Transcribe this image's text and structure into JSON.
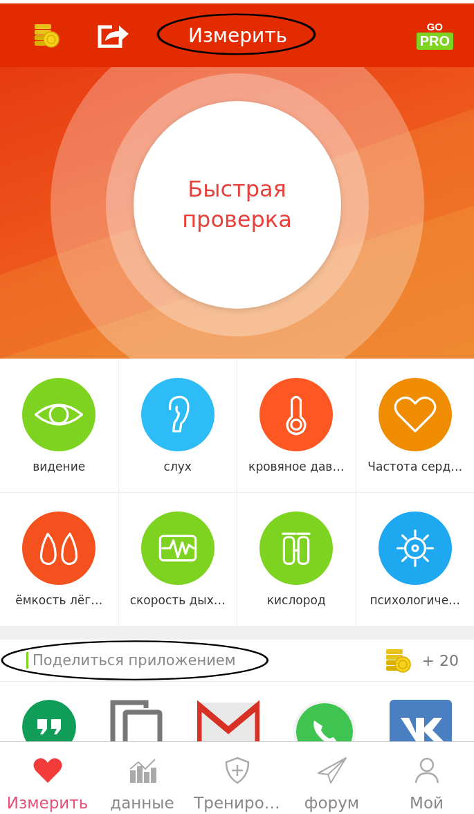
{
  "top_bar": {
    "title": "Измерить",
    "pro_badge": {
      "top": "GO",
      "label": "PRO"
    }
  },
  "hero": {
    "button": "Быстрая проверка"
  },
  "tests": [
    {
      "label": "видение",
      "color": "#7ed321"
    },
    {
      "label": "слух",
      "color": "#2ebcf7"
    },
    {
      "label": "кровяное дав…",
      "color": "#ff5722"
    },
    {
      "label": "Частота серд…",
      "color": "#f08c00"
    },
    {
      "label": "ёмкость лёг…",
      "color": "#f4511e"
    },
    {
      "label": "скорость дых…",
      "color": "#7ed321"
    },
    {
      "label": "кислород",
      "color": "#7ed321"
    },
    {
      "label": "психологиче…",
      "color": "#1ea8ef"
    }
  ],
  "share": {
    "label": "Поделиться приложением",
    "reward": "+ 20"
  },
  "nav": [
    {
      "label": "Измерить",
      "selected": true
    },
    {
      "label": "данные",
      "selected": false
    },
    {
      "label": "Трениро…",
      "selected": false
    },
    {
      "label": "форум",
      "selected": false
    },
    {
      "label": "Мой",
      "selected": false
    }
  ]
}
